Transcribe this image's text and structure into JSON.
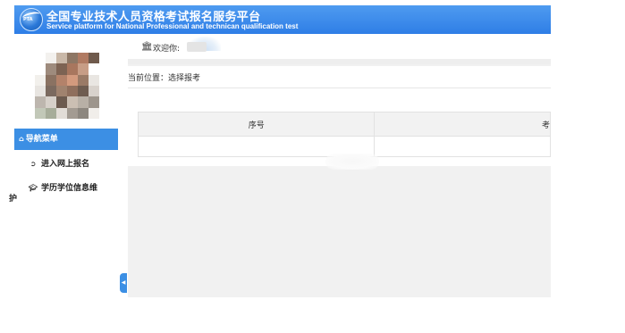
{
  "header": {
    "title_cn": "全国专业技术人员资格考试报名服务平台",
    "title_en": "Service platform for National Professional and technican qualification test",
    "logo_text": "PTA",
    "logo_icon": "pta-globe-logo",
    "bg_color": "#3c8fe4"
  },
  "user": {
    "avatar": "pixelated-profile-photo",
    "welcome_label": "欢迎你:",
    "welcome_icon": "bank-building-icon"
  },
  "nav": {
    "title": "导航菜单",
    "title_icon": "home-icon",
    "items": [
      {
        "label": "进入网上报名",
        "icon": "sign-in-icon"
      },
      {
        "label_line1": "学历学位信息维",
        "label_line2": "护",
        "icon": "graduation-cap-icon"
      }
    ]
  },
  "main": {
    "location": "当前位置：选择报考",
    "table": {
      "columns": [
        "序号",
        "考"
      ]
    }
  },
  "colors": {
    "accent": "#3c8fe4",
    "main_bg": "#f1f1f1"
  }
}
